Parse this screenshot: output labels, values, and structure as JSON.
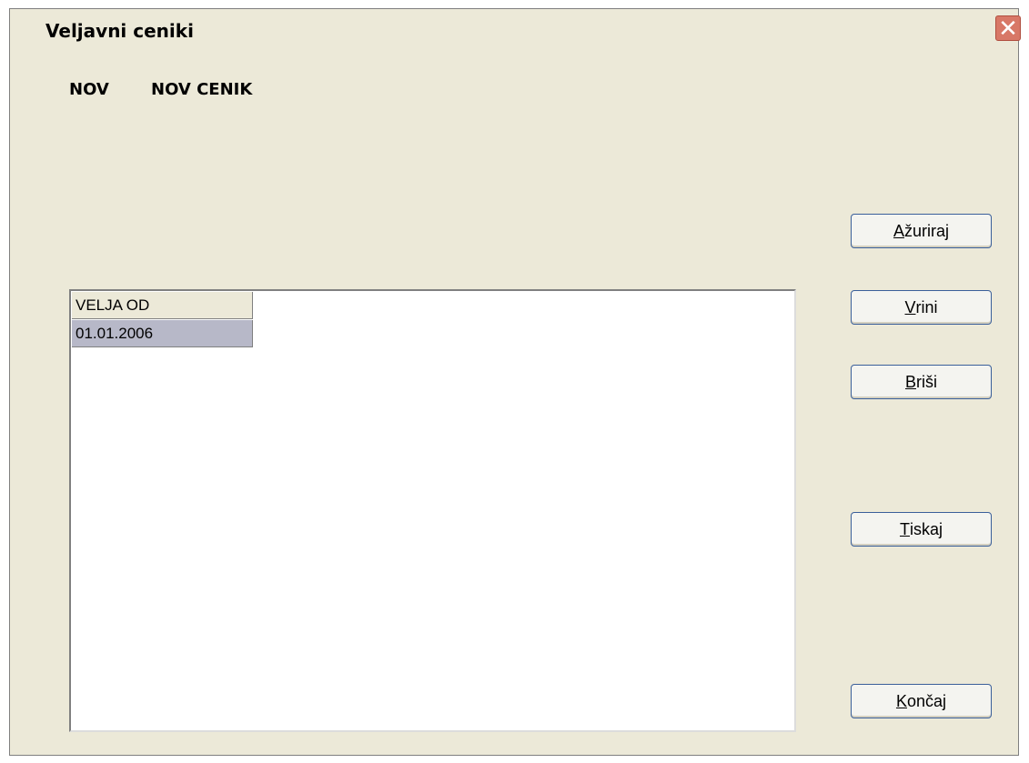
{
  "window": {
    "title": "Veljavni ceniki",
    "close_icon": "close-icon"
  },
  "header": {
    "code": "NOV",
    "name": "NOV CENIK"
  },
  "grid": {
    "columns": [
      "VELJA OD"
    ],
    "rows": [
      [
        "01.01.2006"
      ]
    ]
  },
  "buttons": {
    "azuriraj": {
      "accel": "A",
      "rest": "žuriraj"
    },
    "vrini": {
      "accel": "V",
      "rest": "rini"
    },
    "brisi": {
      "accel": "B",
      "rest": "riši"
    },
    "tiskaj": {
      "accel": "T",
      "rest": "iskaj"
    },
    "koncaj": {
      "accel": "K",
      "rest": "ončaj"
    }
  },
  "colors": {
    "dialog_bg": "#ECE9D8",
    "close_button": "#D87867",
    "selected_row": "#B7B8C8"
  }
}
